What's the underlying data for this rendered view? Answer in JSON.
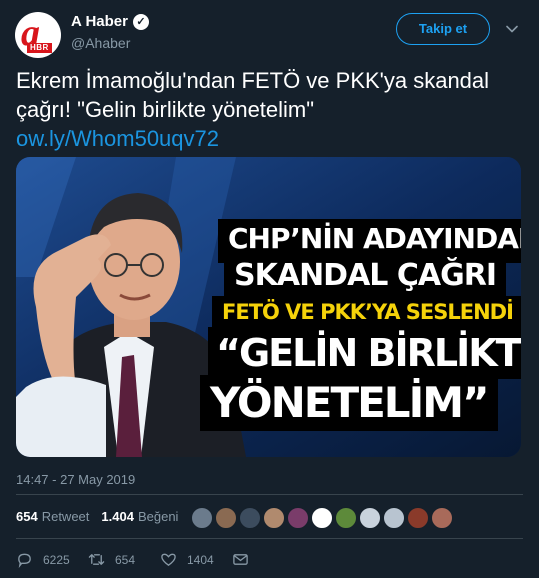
{
  "account": {
    "name": "A Haber",
    "handle": "@Ahaber",
    "avatar_text": "a",
    "avatar_badge": "HBR"
  },
  "follow_label": "Takip et",
  "tweet": {
    "text": "Ekrem İmamoğlu'ndan FETÖ ve PKK'ya skandal çağrı! \"Gelin birlikte yönetelim\"",
    "link": "ow.ly/Whom50uqv72"
  },
  "media": {
    "headline_1": "CHP’NİN ADAYINDAN",
    "headline_2": "SKANDAL ÇAĞRI",
    "headline_3": "FETÖ VE PKK’YA SESLENDİ",
    "headline_4": "“GELİN BİRLİKTE",
    "headline_5": "YÖNETELİM”"
  },
  "timestamp": "14:47 - 27 May 2019",
  "stats": {
    "retweets_count": "654",
    "retweets_label": "Retweet",
    "likes_count": "1.404",
    "likes_label": "Beğeni"
  },
  "liker_avatars": [
    "#6b7b8c",
    "#8a6a52",
    "#3c4c5e",
    "#b08a6e",
    "#7a3c6a",
    "#ffffff",
    "#5d8a3a",
    "#c8d2dc",
    "#b8c4d0",
    "#8a3a2a",
    "#a86a5a"
  ],
  "actions": {
    "replies": "6225",
    "retweets": "654",
    "likes": "1404"
  },
  "colors": {
    "background": "#15202b",
    "accent": "#1da1f2",
    "link": "#1b95e0",
    "muted": "#8899a6",
    "divider": "#38444d",
    "brand_red": "#d8161c",
    "headline_yellow": "#f5d20a"
  }
}
